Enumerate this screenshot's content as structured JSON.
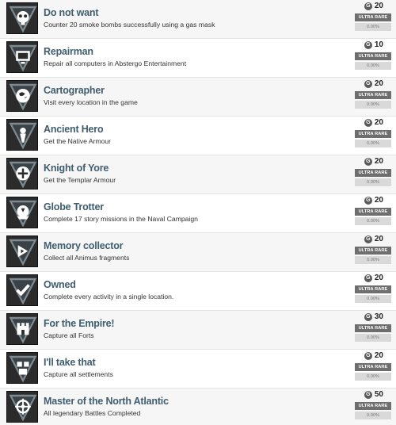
{
  "colors": {
    "title": "#3f5d6e",
    "rarity_bg": "#6e6e6e",
    "pct_bg": "#d9d9d9",
    "tile_bg": "#2b2b2b"
  },
  "achievements": [
    {
      "title": "Do not want",
      "description": "Counter 20 smoke bombs successfully using a gas mask",
      "points": "20",
      "rarity": "ULTRA RARE",
      "percent": "0.00%",
      "icon": "gas-mask-icon"
    },
    {
      "title": "Repairman",
      "description": "Repair all computers in Abstergo Entertainment",
      "points": "10",
      "rarity": "ULTRA RARE",
      "percent": "0.00%",
      "icon": "computer-icon"
    },
    {
      "title": "Cartographer",
      "description": "Visit every location in the game",
      "points": "20",
      "rarity": "ULTRA RARE",
      "percent": "0.00%",
      "icon": "globe-icon"
    },
    {
      "title": "Ancient Hero",
      "description": "Get the Native Armour",
      "points": "20",
      "rarity": "ULTRA RARE",
      "percent": "0.00%",
      "icon": "native-armour-icon"
    },
    {
      "title": "Knight of Yore",
      "description": "Get the Templar Armour",
      "points": "20",
      "rarity": "ULTRA RARE",
      "percent": "0.00%",
      "icon": "templar-cross-icon"
    },
    {
      "title": "Globe Trotter",
      "description": "Complete 17 story missions in the Naval Campaign",
      "points": "20",
      "rarity": "ULTRA RARE",
      "percent": "0.00%",
      "icon": "ship-globe-icon"
    },
    {
      "title": "Memory collector",
      "description": "Collect all Animus fragments",
      "points": "20",
      "rarity": "ULTRA RARE",
      "percent": "0.00%",
      "icon": "animus-fragment-icon"
    },
    {
      "title": "Owned",
      "description": "Complete every activity in a single location.",
      "points": "20",
      "rarity": "ULTRA RARE",
      "percent": "0.00%",
      "icon": "checkmark-icon"
    },
    {
      "title": "For the Empire!",
      "description": "Capture all Forts",
      "points": "30",
      "rarity": "ULTRA RARE",
      "percent": "0.00%",
      "icon": "fort-icon"
    },
    {
      "title": "I'll take that",
      "description": "Capture all settlements",
      "points": "20",
      "rarity": "ULTRA RARE",
      "percent": "0.00%",
      "icon": "settlement-icon"
    },
    {
      "title": "Master of the North Atlantic",
      "description": "All legendary Battles Completed",
      "points": "50",
      "rarity": "ULTRA RARE",
      "percent": "0.00%",
      "icon": "ship-wheel-icon"
    }
  ]
}
